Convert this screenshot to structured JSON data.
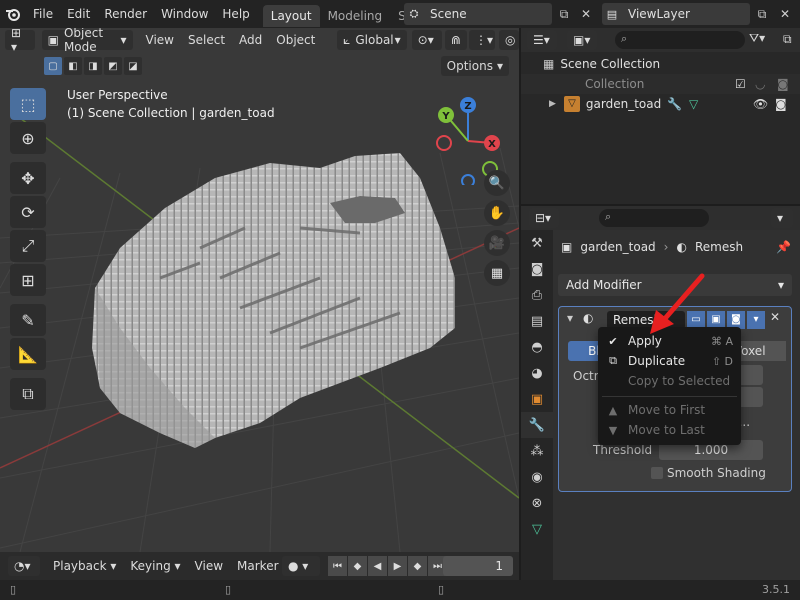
{
  "menubar": {
    "menus": [
      "File",
      "Edit",
      "Render",
      "Window",
      "Help"
    ],
    "tabs": [
      "Layout",
      "Modeling",
      "Scu"
    ],
    "active_tab": "Layout",
    "scene": "Scene",
    "view_layer": "ViewLayer"
  },
  "viewport": {
    "mode": "Object Mode",
    "menus": [
      "View",
      "Select",
      "Add",
      "Object"
    ],
    "orientation": "Global",
    "options": "Options",
    "info_line1": "User Perspective",
    "info_line2": "(1) Scene Collection | garden_toad",
    "gizmo": {
      "y": "Y",
      "z": "Z",
      "x": "X"
    }
  },
  "timeline": {
    "menus": [
      "Playback",
      "Keying",
      "View",
      "Marker"
    ],
    "frame": "1"
  },
  "status": {
    "version": "3.5.1"
  },
  "outliner": {
    "root": "Scene Collection",
    "collection": "Collection",
    "object": "garden_toad"
  },
  "properties": {
    "object": "garden_toad",
    "modifier": "Remesh",
    "add_modifier": "Add Modifier",
    "modifier_name": "Remesh",
    "mode_tabs": [
      "Block",
      "",
      "Voxel"
    ],
    "octree_label": "Octr",
    "threshold_label": "Threshold",
    "threshold_value": "1.000",
    "smooth_shading": "Smooth Shading",
    "partial_label": "n..."
  },
  "context_menu": {
    "items": [
      {
        "label": "Apply",
        "shortcut": "⌘ A",
        "icon": "check-icon",
        "enabled": true
      },
      {
        "label": "Duplicate",
        "shortcut": "⇧ D",
        "icon": "duplicate-icon",
        "enabled": true
      },
      {
        "label": "Copy to Selected",
        "shortcut": "",
        "icon": "",
        "enabled": false
      },
      {
        "label": "Move to First",
        "shortcut": "",
        "icon": "triangle-up-icon",
        "enabled": false
      },
      {
        "label": "Move to Last",
        "shortcut": "",
        "icon": "triangle-down-icon",
        "enabled": false
      }
    ]
  },
  "colors": {
    "accent": "#4a72b0",
    "arrow": "#e82020",
    "gizmo_x": "#e0444c",
    "gizmo_y": "#7fc03a",
    "gizmo_z": "#3b7fd9"
  }
}
